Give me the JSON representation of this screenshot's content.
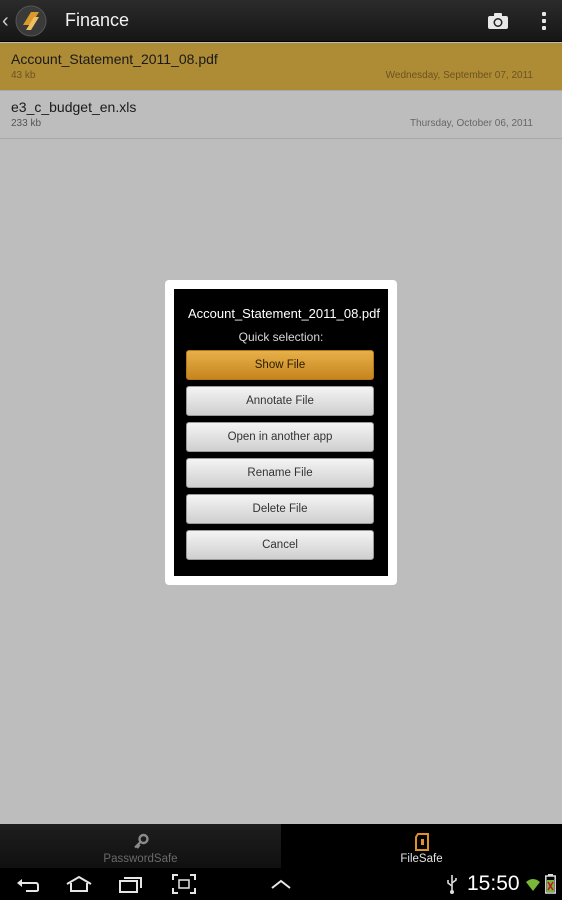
{
  "header": {
    "title": "Finance",
    "back_icon": "back-chevron-icon",
    "logo_icon": "filesafe-logo-icon",
    "camera_icon": "camera-icon",
    "overflow_icon": "overflow-menu-icon"
  },
  "files": [
    {
      "name": "Account_Statement_2011_08.pdf",
      "size": "43 kb",
      "date": "Wednesday, September 07, 2011",
      "selected": true
    },
    {
      "name": "e3_c_budget_en.xls",
      "size": "233 kb",
      "date": "Thursday, October 06, 2011",
      "selected": false
    }
  ],
  "dialog": {
    "title": "Account_Statement_2011_08.pdf",
    "subtitle": "Quick selection:",
    "buttons": [
      "Show File",
      "Annotate File",
      "Open in another app",
      "Rename File",
      "Delete File",
      "Cancel"
    ]
  },
  "tabs": [
    {
      "label": "PasswordSafe",
      "icon": "key-icon",
      "active": false
    },
    {
      "label": "FileSafe",
      "icon": "sd-card-icon",
      "active": true
    }
  ],
  "system": {
    "time": "15:50"
  },
  "colors": {
    "accent": "#c6851d",
    "selected_row": "#ae8b35",
    "background": "#bdbdbd"
  }
}
